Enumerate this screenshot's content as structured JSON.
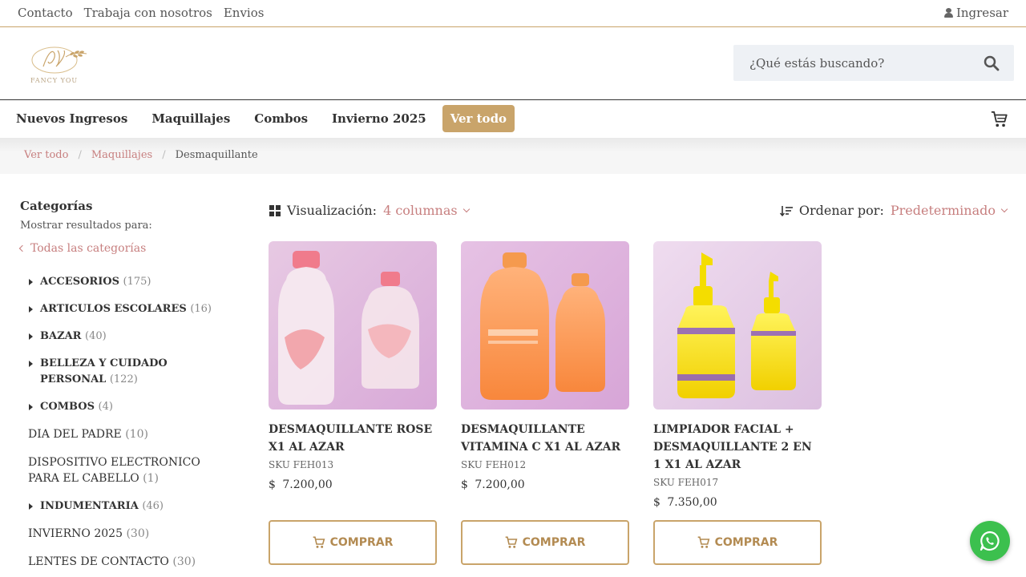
{
  "topbar": {
    "links": [
      "Contacto",
      "Trabaja con nosotros",
      "Envios"
    ],
    "login": "Ingresar"
  },
  "header": {
    "logo_text": "FANCY YOU",
    "search_placeholder": "¿Qué estás buscando?"
  },
  "nav": {
    "items": [
      "Nuevos Ingresos",
      "Maquillajes",
      "Combos",
      "Invierno 2025"
    ],
    "cta": "Ver todo"
  },
  "breadcrumb": {
    "items": [
      "Ver todo",
      "Maquillajes"
    ],
    "separator": "/",
    "current": "Desmaquillante"
  },
  "sidebar": {
    "title": "Categorías",
    "subtitle": "Mostrar resultados para:",
    "all_label": "Todas las categorías",
    "categories": [
      {
        "label": "ACCESORIOS",
        "count": "(175)",
        "expandable": true
      },
      {
        "label": "ARTICULOS ESCOLARES",
        "count": "(16)",
        "expandable": true
      },
      {
        "label": "BAZAR",
        "count": "(40)",
        "expandable": true
      },
      {
        "label": "BELLEZA Y CUIDADO PERSONAL",
        "count": "(122)",
        "expandable": true
      },
      {
        "label": "COMBOS",
        "count": "(4)",
        "expandable": true
      },
      {
        "label": "DIA DEL PADRE",
        "count": "(10)",
        "expandable": false
      },
      {
        "label": "DISPOSITIVO ELECTRONICO PARA EL CABELLO",
        "count": "(1)",
        "expandable": false
      },
      {
        "label": "INDUMENTARIA",
        "count": "(46)",
        "expandable": true
      },
      {
        "label": "INVIERNO 2025",
        "count": "(30)",
        "expandable": false
      },
      {
        "label": "LENTES DE CONTACTO",
        "count": "(30)",
        "expandable": false
      }
    ]
  },
  "toolbar": {
    "view_label": "Visualización:",
    "view_value": "4 columnas",
    "sort_label": "Ordenar por:",
    "sort_value": "Predeterminado"
  },
  "products": [
    {
      "name": "DESMAQUILLANTE ROSE X1 AL AZAR",
      "sku": "SKU FEH013",
      "price": "$ 7.200,00",
      "buy": "COMPRAR"
    },
    {
      "name": "DESMAQUILLANTE VITAMINA C X1 AL AZAR",
      "sku": "SKU FEH012",
      "price": "$ 7.200,00",
      "buy": "COMPRAR"
    },
    {
      "name": "LIMPIADOR FACIAL + DESMAQUILLANTE 2 EN 1 X1 AL AZAR",
      "sku": "SKU FEH017",
      "price": "$ 7.350,00",
      "buy": "COMPRAR"
    }
  ],
  "colors": {
    "accent": "#c9a46a",
    "link": "#c77f7f",
    "whatsapp": "#3cc04e"
  }
}
